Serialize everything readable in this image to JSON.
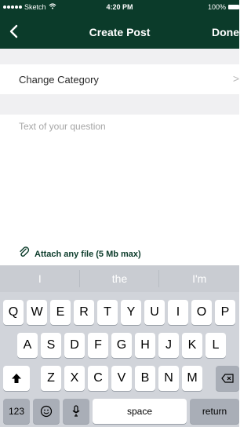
{
  "status": {
    "carrier": "Sketch",
    "time": "4:20 PM",
    "battery": "100%"
  },
  "nav": {
    "title": "Create Post",
    "done_label": "Done"
  },
  "form": {
    "category_label": "Change Category",
    "question_placeholder": "Text of your question",
    "attach_label": "Attach any file (5 Mb max)"
  },
  "keyboard": {
    "suggestions": [
      "I",
      "the",
      "I'm"
    ],
    "row1": [
      "Q",
      "W",
      "E",
      "R",
      "T",
      "Y",
      "U",
      "I",
      "O",
      "P"
    ],
    "row2": [
      "A",
      "S",
      "D",
      "F",
      "G",
      "H",
      "J",
      "K",
      "L"
    ],
    "row3": [
      "Z",
      "X",
      "C",
      "V",
      "B",
      "N",
      "M"
    ],
    "numbers_label": "123",
    "space_label": "space",
    "return_label": "return"
  },
  "colors": {
    "brand_dark_green": "#0b3b2a",
    "background_gray": "#f0f0f2",
    "keyboard_bg": "#d1d4da"
  },
  "icons": {
    "back": "chevron-left-icon",
    "wifi": "wifi-icon",
    "battery": "battery-icon",
    "chevron": "chevron-right-icon",
    "attach": "paperclip-icon",
    "shift": "shift-icon",
    "backspace": "backspace-icon",
    "emoji": "emoji-icon",
    "mic": "microphone-icon"
  }
}
